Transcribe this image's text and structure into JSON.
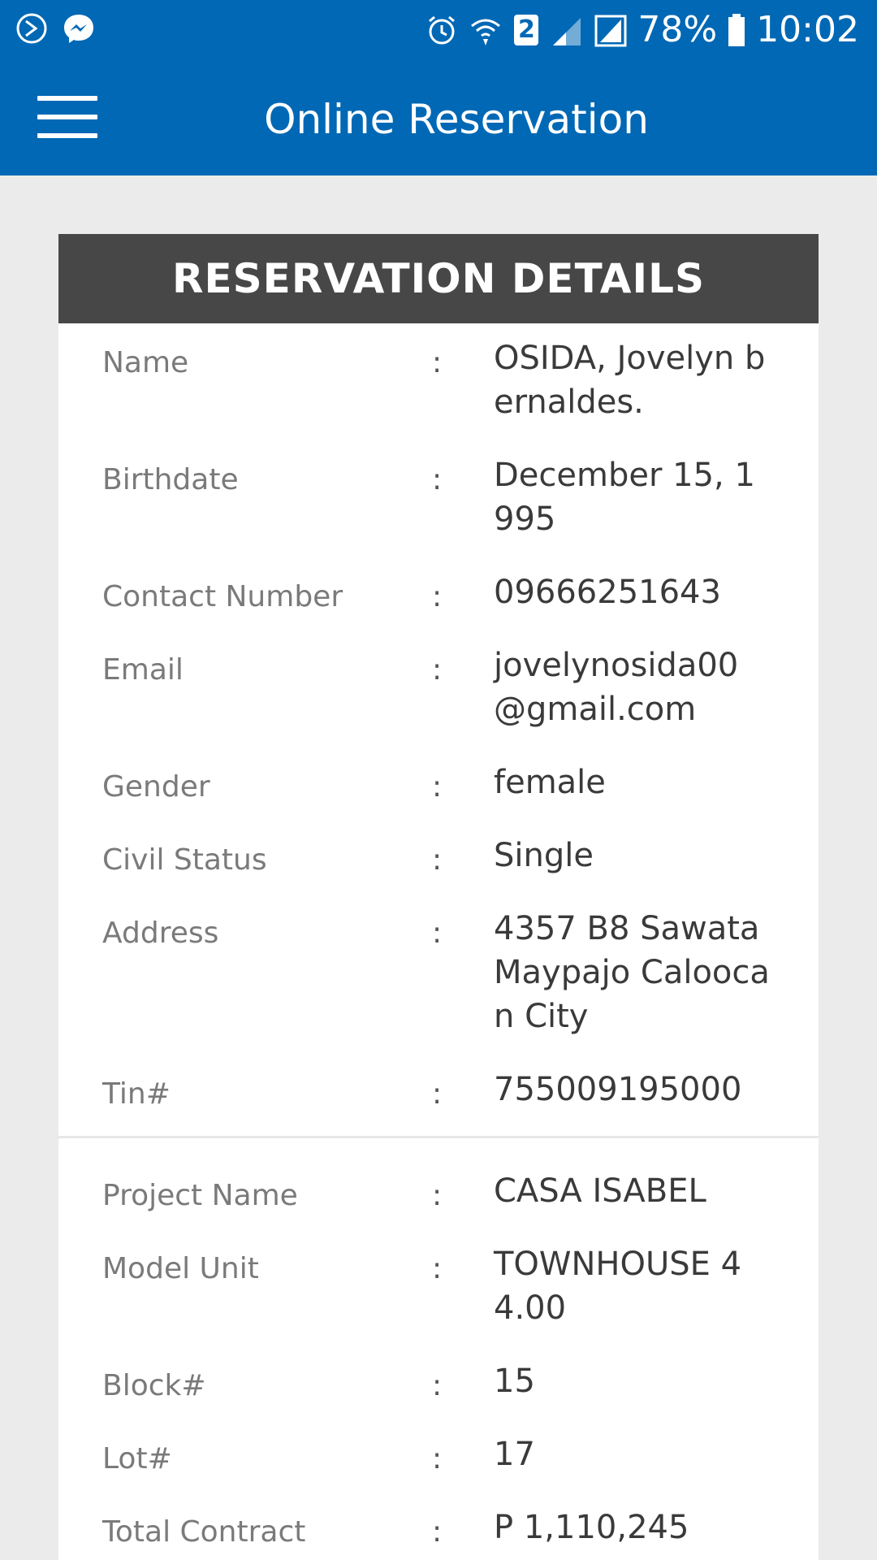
{
  "status_bar": {
    "battery": "78%",
    "time": "10:02",
    "sim_badge": "2"
  },
  "app": {
    "title": "Online Reservation"
  },
  "card": {
    "header": "RESERVATION DETAILS",
    "personal": [
      {
        "label": "Name",
        "value": "OSIDA, Jovelyn bernaldes."
      },
      {
        "label": "Birthdate",
        "value": "December 15, 1995"
      },
      {
        "label": "Contact Number",
        "value": "09666251643"
      },
      {
        "label": "Email",
        "value": "jovelynosida00@gmail.com"
      },
      {
        "label": "Gender",
        "value": "female"
      },
      {
        "label": "Civil Status",
        "value": "Single"
      },
      {
        "label": "Address",
        "value": "4357 B8 Sawata Maypajo Caloocan City"
      },
      {
        "label": "Tin#",
        "value": "755009195000"
      }
    ],
    "property": [
      {
        "label": "Project Name",
        "value": "CASA ISABEL"
      },
      {
        "label": "Model Unit",
        "value": "TOWNHOUSE 44.00"
      },
      {
        "label": "Block#",
        "value": "15"
      },
      {
        "label": "Lot#",
        "value": "17"
      },
      {
        "label": "Total Contract price",
        "value": "P 1,110,245"
      }
    ],
    "colon": ":"
  },
  "colors": {
    "primary": "#0068b5",
    "header_bg": "#474747",
    "page_bg": "#ebebeb"
  }
}
